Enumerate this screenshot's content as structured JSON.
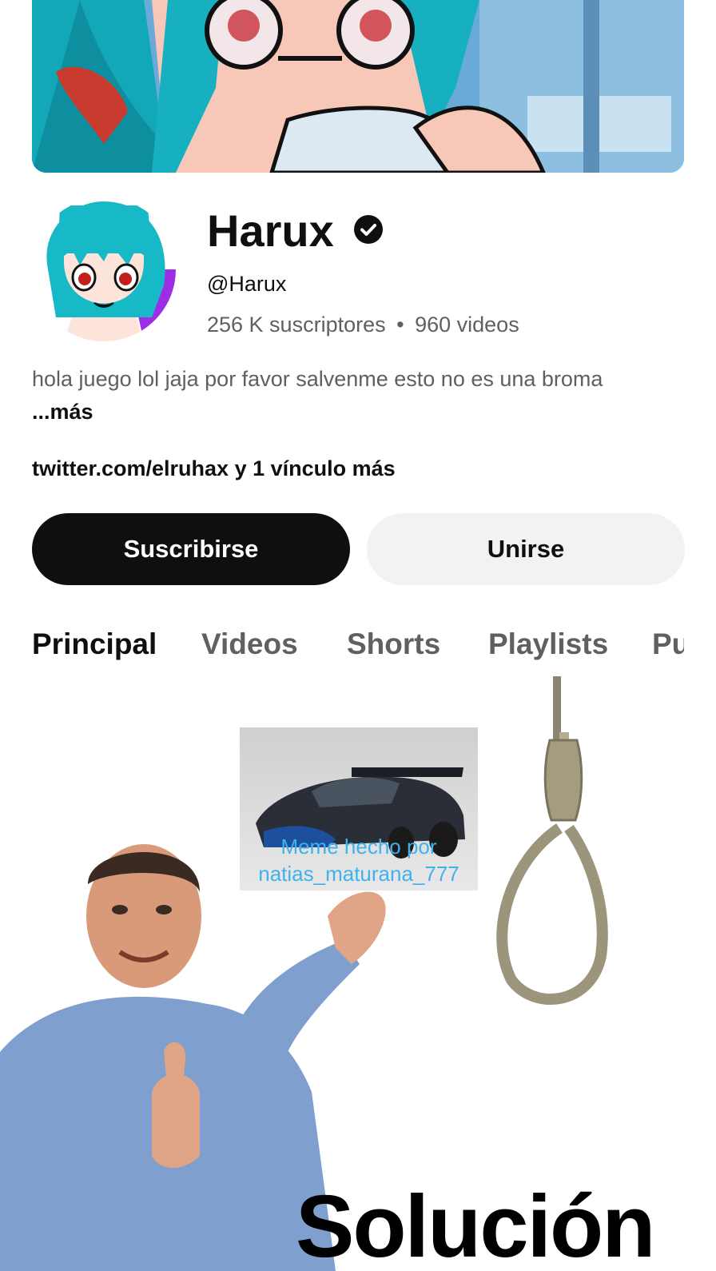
{
  "channel": {
    "name": "Harux",
    "handle": "@Harux",
    "subscribers": "256 K suscriptores",
    "separator": "•",
    "videos": "960 videos",
    "description": "hola juego lol jaja por favor salvenme esto no es una broma",
    "more_label": "...más",
    "links_text": "twitter.com/elruhax y 1 vínculo más"
  },
  "buttons": {
    "subscribe": "Suscribirse",
    "join": "Unirse"
  },
  "tabs": [
    {
      "label": "Principal",
      "active": true
    },
    {
      "label": "Videos"
    },
    {
      "label": "Shorts"
    },
    {
      "label": "Playlists"
    },
    {
      "label": "Pu"
    }
  ],
  "meme": {
    "caption_line1": "Meme hecho por",
    "caption_line2": "natias_maturana_777",
    "solution_text": "Solución"
  },
  "icons": {
    "verified": "verified-check-icon"
  },
  "colors": {
    "primary_text": "#0f0f0f",
    "secondary_text": "#606060",
    "subscribe_bg": "#0f0f0f",
    "join_bg": "#f2f2f2",
    "caption": "#3fb2ee"
  }
}
